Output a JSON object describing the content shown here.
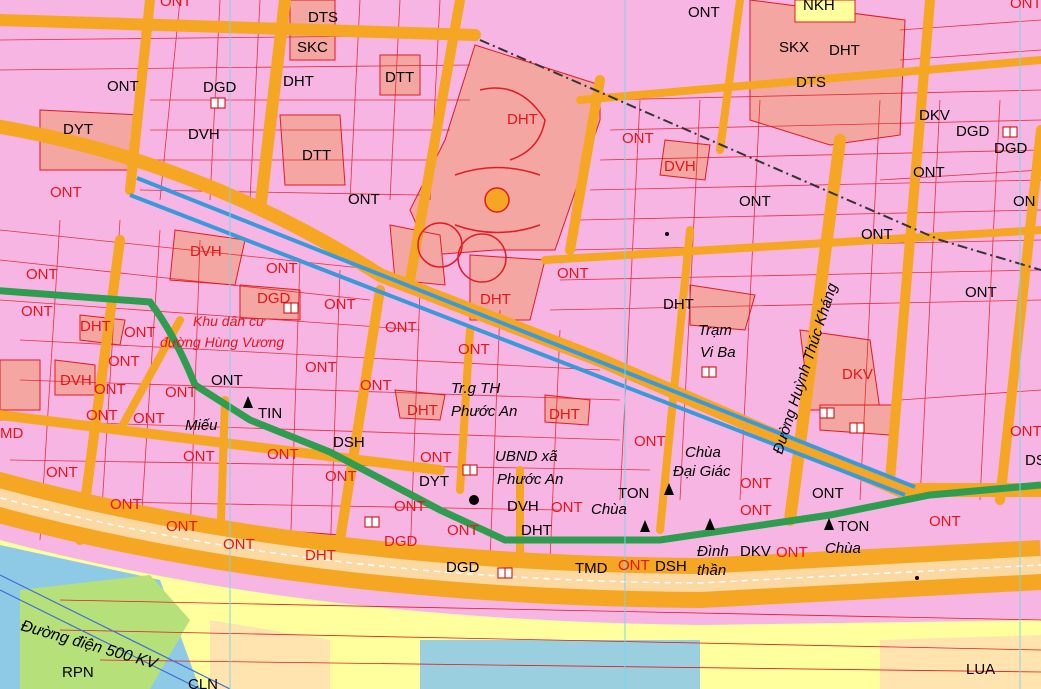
{
  "map": {
    "labels": {
      "ont": "ONT",
      "dht": "DHT",
      "dvh": "DVH",
      "dgd": "DGD",
      "dyt": "DYT",
      "dtt": "DTT",
      "dts": "DTS",
      "skc": "SKC",
      "skx": "SKX",
      "nkh": "NKH",
      "dkv": "DKV",
      "dsh": "DSH",
      "tin": "TIN",
      "ton": "TON",
      "tmd": "TMD",
      "rpn": "RPN",
      "lua": "LUA",
      "cln": "CLN",
      "md": "MD",
      "ds": "DS",
      "on": "ON"
    },
    "places": {
      "khu_dan_cu_1": "Khu dân cư",
      "khu_dan_cu_2": "đường Hùng Vương",
      "mieu": "Miếu",
      "truong_1": "Tr.g TH",
      "truong_2": "Phước An",
      "ubnd_1": "UBND xã",
      "ubnd_2": "Phước An",
      "tram_1": "Trạm",
      "tram_2": "Vi Ba",
      "chua_dai_giac_1": "Chùa",
      "chua_dai_giac_2": "Đại Giác",
      "chua_a": "Chùa",
      "chua_b": "Chùa",
      "dinh_1": "Đình",
      "dinh_2": "thần",
      "duong_huynh_thuc_khang": "Đường Huỳnh Thúc Kháng",
      "duong_dien_500kv": "Đường điện 500 KV"
    },
    "colors": {
      "residential": "#f6b5e2",
      "public": "#f4a6a2",
      "road": "#f5a623",
      "parcel_border": "#e31b23",
      "highway": "#2e9d4f",
      "planned_road": "#3a9ad9",
      "rice": "#ffff9e",
      "forest": "#b6e07a",
      "water": "#8ecae6"
    }
  }
}
